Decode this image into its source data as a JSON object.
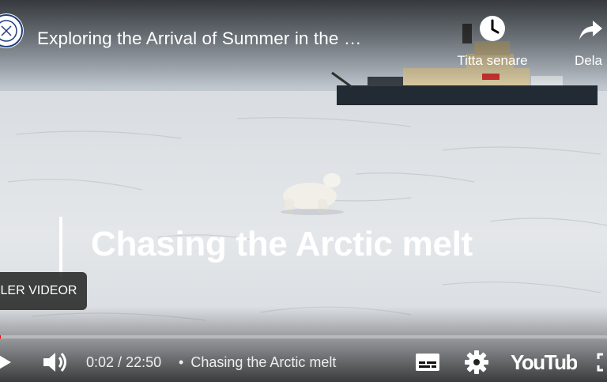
{
  "header": {
    "title": "Exploring the Arrival of Summer in the …",
    "watch_later_label": "Titta senare",
    "share_label": "Dela",
    "channel_icon": "university-seal-icon"
  },
  "overlay": {
    "title": "Chasing the Arctic melt",
    "more_videos_label": "LER VIDEOR"
  },
  "controls": {
    "current_time": "0:02",
    "separator": " / ",
    "duration": "22:50",
    "chapter_dot": "•",
    "chapter_title": "Chasing the Arctic melt",
    "progress_fraction": 0.0015,
    "icons": [
      "play-icon",
      "volume-icon",
      "subtitles-icon",
      "settings-gear-icon",
      "youtube-logo-icon",
      "fullscreen-icon"
    ],
    "brand_color": "#ff0000"
  }
}
